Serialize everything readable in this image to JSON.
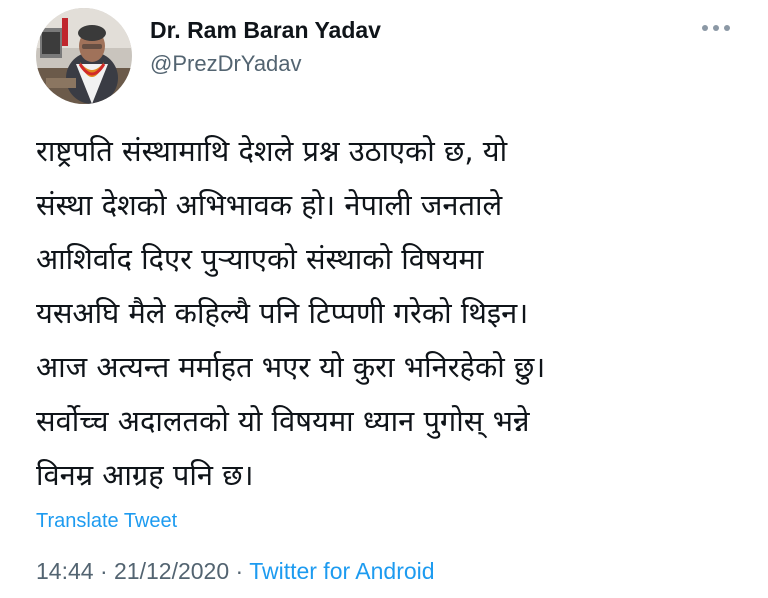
{
  "tweet": {
    "author_name": "Dr. Ram Baran Yadav",
    "author_handle": "@PrezDrYadav",
    "more_icon": "more-horizontal-icon",
    "text_lines": [
      "राष्ट्रपति संस्थामाथि देशले प्रश्न उठाएको छ, यो",
      "संस्था देशको अभिभावक हो। नेपाली जनताले",
      "आशिर्वाद दिएर पुर्‍याएको संस्थाको विषयमा",
      "यसअघि मैले कहिल्यै पनि टिप्पणी गरेको थिइन।",
      "आज अत्यन्त मर्माहत भएर यो कुरा भनिरहेको छु।",
      "सर्वोच्च अदालतको यो विषयमा ध्यान पुगोस् भन्ने",
      "विनम्र आग्रह पनि छ।"
    ],
    "translate_label": "Translate Tweet",
    "time": "14:44",
    "date": "21/12/2020",
    "separator": "·",
    "source": "Twitter for Android"
  },
  "colors": {
    "text": "#0f1419",
    "secondary": "#536471",
    "link": "#1d9bf0"
  }
}
